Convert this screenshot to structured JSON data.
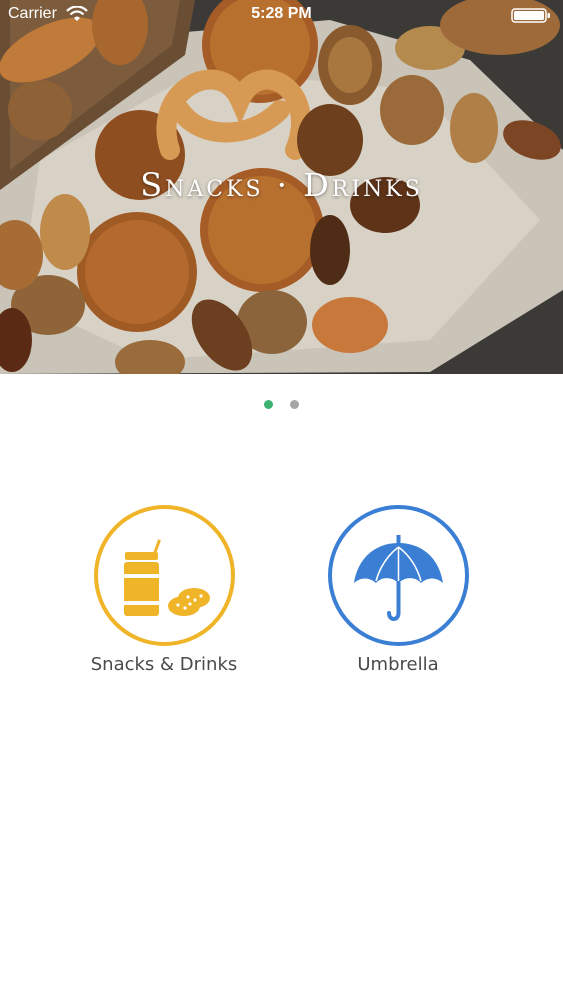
{
  "status_bar": {
    "carrier": "Carrier",
    "time": "5:28 PM"
  },
  "hero": {
    "title": "Snacks · Drinks",
    "icon": "snacks-photo"
  },
  "pager": {
    "page_count": 2,
    "current_page": 1,
    "active_color": "#3cb371",
    "inactive_color": "#a6a6a6"
  },
  "categories": [
    {
      "label": "Snacks & Drinks",
      "icon": "snacks-drinks-icon",
      "color": "#f0b429"
    },
    {
      "label": "Umbrella",
      "icon": "umbrella-icon",
      "color": "#3b7fd4"
    }
  ]
}
